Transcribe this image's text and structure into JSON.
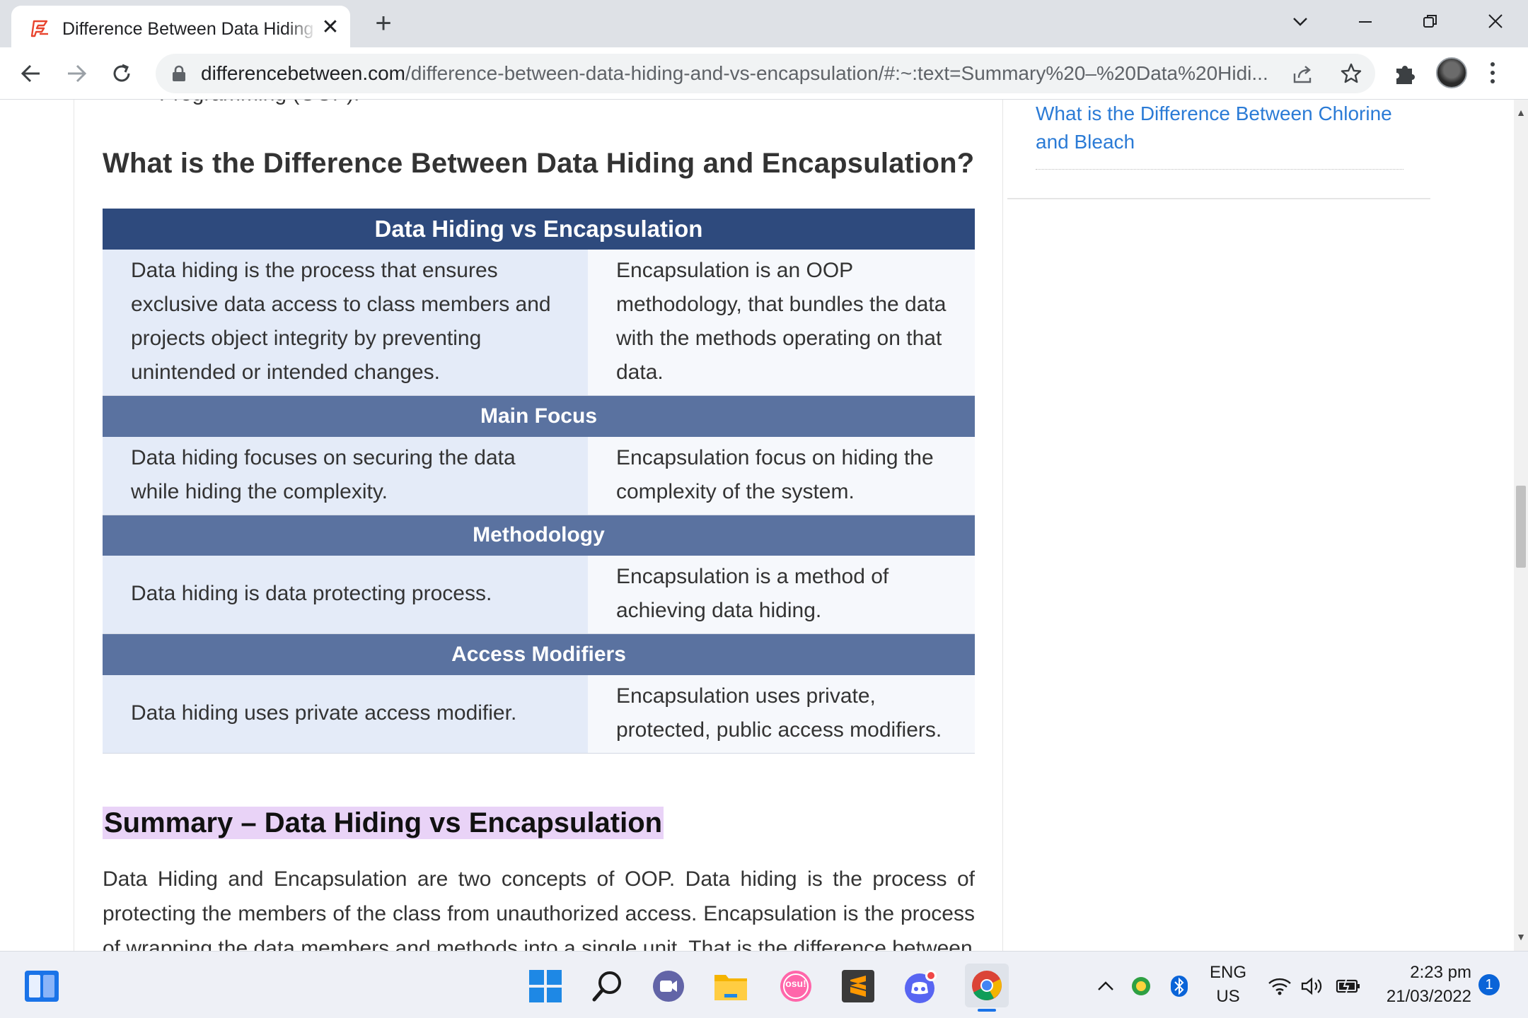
{
  "browser": {
    "tab_title": "Difference Between Data Hiding and Encapsulation",
    "url_host": "differencebetween.com",
    "url_path": "/difference-between-data-hiding-and-vs-encapsulation/#:~:text=Summary%20–%20Data%20Hidi...",
    "accent_color": "#e8442e"
  },
  "page": {
    "cut_line": "Programming (OOP).",
    "section_heading": "What is the Difference Between Data Hiding and Encapsulation?",
    "table": {
      "title": "Data Hiding vs Encapsulation",
      "intro_left": "Data hiding is the process that ensures exclusive data access to class members and projects object integrity by preventing unintended or intended changes.",
      "intro_right": "Encapsulation is an OOP methodology, that bundles the data with the methods operating on that data.",
      "sections": [
        {
          "heading": "Main Focus",
          "left": "Data hiding focuses on securing the data while hiding the complexity.",
          "right": "Encapsulation focus on hiding the complexity of the system."
        },
        {
          "heading": "Methodology",
          "left": "Data hiding is data protecting process.",
          "right": "Encapsulation is a method of achieving data hiding."
        },
        {
          "heading": "Access Modifiers",
          "left": "Data hiding uses private access modifier.",
          "right": "Encapsulation uses private, protected, public access modifiers."
        }
      ]
    },
    "summary_heading": "Summary – Data Hiding vs Encapsulation",
    "summary_text": "Data Hiding and Encapsulation are two concepts of OOP. Data hiding is the process of protecting the members of the class from unauthorized access. Encapsulation is the process of wrapping the data members and methods into a single unit. That is the difference between"
  },
  "sidebar": {
    "related_link": "What is the Difference Between Chlorine and Bleach"
  },
  "taskbar": {
    "language": "ENG",
    "region": "US",
    "time": "2:23 pm",
    "date": "21/03/2022",
    "notification_count": "1",
    "osu_label": "osu!"
  }
}
